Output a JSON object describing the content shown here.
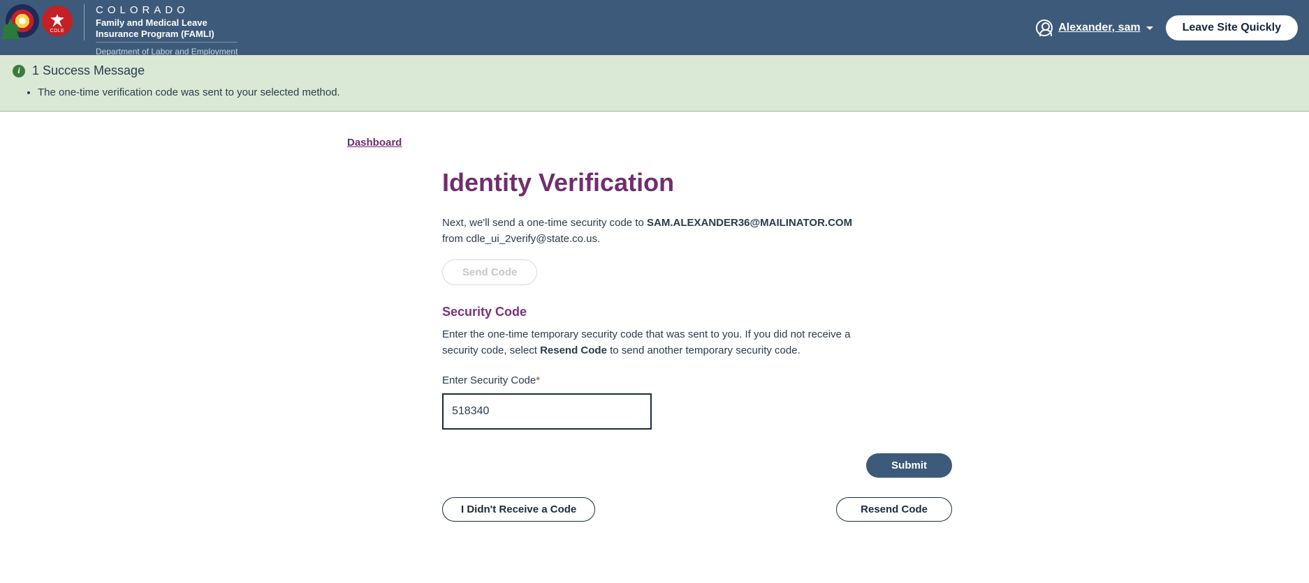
{
  "header": {
    "state": "COLORADO",
    "program_line1": "Family and Medical Leave",
    "program_line2": "Insurance Program (FAMLI)",
    "department": "Department of Labor and Employment",
    "user_name": "Alexander, sam",
    "leave_label": "Leave Site Quickly"
  },
  "alert": {
    "title": "1 Success Message",
    "items": [
      "The one-time verification code was sent to your selected method."
    ]
  },
  "breadcrumb": {
    "dashboard": "Dashboard"
  },
  "page": {
    "title": "Identity Verification",
    "intro_prefix": "Next, we'll send a one-time security code to ",
    "intro_email": "SAM.ALEXANDER36@MAILINATOR.COM",
    "intro_middle": " from ",
    "intro_from": "cdle_ui_2verify@state.co.us.",
    "send_code": "Send Code",
    "section_title": "Security Code",
    "section_desc_pre": "Enter the one-time temporary security code that was sent to you. If you did not receive a security code, select ",
    "section_desc_bold": "Resend Code",
    "section_desc_post": " to send another temporary security code.",
    "field_label": "Enter Security Code",
    "code_value": "518340",
    "submit": "Submit",
    "noreceive": "I Didn't Receive a Code",
    "resend": "Resend Code"
  }
}
